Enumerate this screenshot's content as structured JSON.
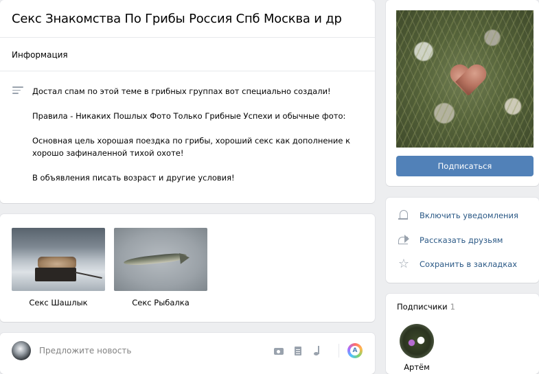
{
  "group": {
    "title": "Секс Знакомства По Грибы Россия Спб Москва и др",
    "info_label": "Информация",
    "description": [
      "Достал спам по этой теме в грибных группах вот специально создали!",
      "Правила - Никаких Пошлых Фото Только Грибные Успехи и обычные фото:",
      "Основная цель хорошая поездка по грибы, хороший секс как дополнение к хорошо зафиналенной тихой охоте!",
      "В объявления писать возраст и другие условия!"
    ]
  },
  "albums": [
    {
      "label": "Секс Шашлык"
    },
    {
      "label": "Секс Рыбалка"
    }
  ],
  "post": {
    "placeholder": "Предложите новость",
    "author_icon": "A"
  },
  "cover": {
    "subscribe_label": "Подписаться"
  },
  "actions": [
    {
      "icon": "bell-icon",
      "label": "Включить уведомления"
    },
    {
      "icon": "share-icon",
      "label": "Рассказать друзьям"
    },
    {
      "icon": "star-icon",
      "label": "Сохранить в закладках"
    }
  ],
  "members": {
    "title": "Подписчики",
    "count": "1",
    "list": [
      {
        "name": "Артём"
      }
    ]
  },
  "colors": {
    "accent": "#5181b8",
    "link": "#2a5885",
    "background": "#edeef0",
    "icon": "#99a2ad"
  }
}
